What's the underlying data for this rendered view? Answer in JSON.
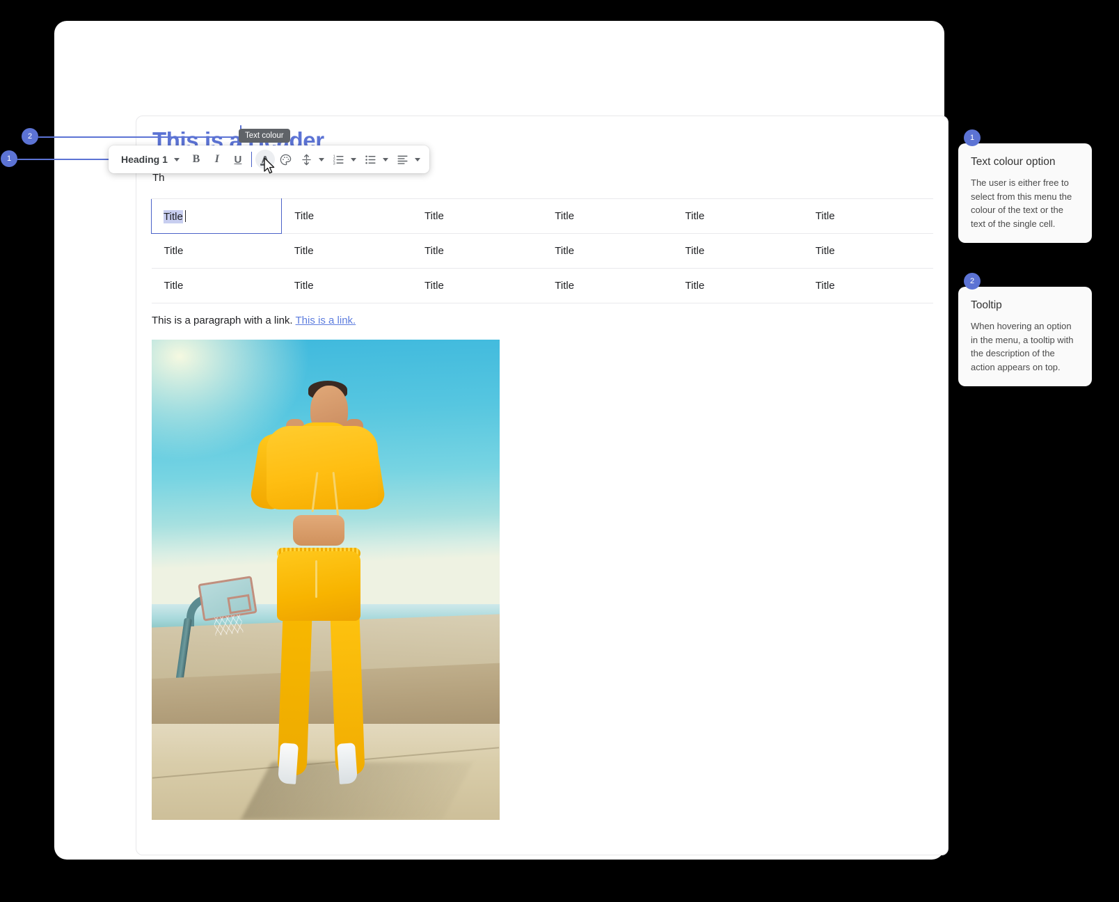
{
  "document": {
    "header": "This is a Header",
    "subline": "Th",
    "paragraph_text": "This is a paragraph with a link.",
    "paragraph_link": "This is a link.",
    "table": {
      "rows": [
        [
          "Title",
          "Title",
          "Title",
          "Title",
          "Title",
          "Title"
        ],
        [
          "Title",
          "Title",
          "Title",
          "Title",
          "Title",
          "Title"
        ],
        [
          "Title",
          "Title",
          "Title",
          "Title",
          "Title",
          "Title"
        ]
      ],
      "active_cell": {
        "row": 0,
        "col": 0,
        "value": "Title"
      }
    },
    "image_alt": "Woman in yellow cropped hoodie and yellow sweatpants with white ankle boots standing on concrete with a basketball hoop and blue sky"
  },
  "toolbar": {
    "heading_label": "Heading 1",
    "buttons": [
      {
        "name": "bold",
        "glyph": "B"
      },
      {
        "name": "italic",
        "glyph": "I"
      },
      {
        "name": "underline",
        "glyph": "U"
      },
      {
        "name": "text-colour",
        "glyph": "A"
      },
      {
        "name": "highlight-colour",
        "glyph": "palette"
      },
      {
        "name": "line-spacing",
        "glyph": "line-spacing"
      },
      {
        "name": "numbered-list",
        "glyph": "numbered-list"
      },
      {
        "name": "bullet-list",
        "glyph": "bullet-list"
      },
      {
        "name": "align",
        "glyph": "align-left"
      }
    ],
    "active_button": "text-colour"
  },
  "tooltip": {
    "text": "Text colour"
  },
  "annotations": {
    "markers": [
      {
        "id": "1",
        "label": "1"
      },
      {
        "id": "2",
        "label": "2"
      }
    ],
    "cards": [
      {
        "badge": "1",
        "title": "Text colour option",
        "body": "The user is either free to select from this menu the colour of the text or the text of the single cell."
      },
      {
        "badge": "2",
        "title": "Tooltip",
        "body": "When hovering an option in the menu, a tooltip with the description of the action appears on top."
      }
    ]
  },
  "colors": {
    "accent": "#5c73d4",
    "header_text": "#5c73d4",
    "link": "#5c7cde",
    "selection": "#c8cef0",
    "tooltip_bg": "#5f6368",
    "toolbar_active_bg": "#eceef1",
    "card_bg": "#fafafa",
    "page_bg": "#000000"
  }
}
